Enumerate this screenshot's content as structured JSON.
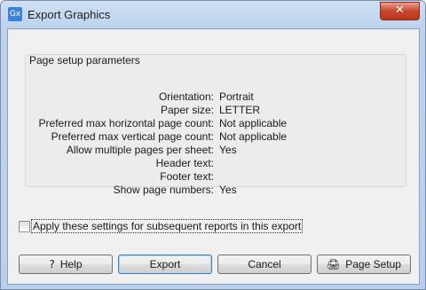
{
  "window": {
    "title": "Export Graphics",
    "app_icon_text": "Gx",
    "close_glyph": "✕"
  },
  "group": {
    "title": "Page setup parameters",
    "rows": [
      {
        "label": "Orientation:",
        "value": "Portrait"
      },
      {
        "label": "Paper size:",
        "value": "LETTER"
      },
      {
        "label": "Preferred max horizontal page count:",
        "value": "Not applicable"
      },
      {
        "label": "Preferred max vertical page count:",
        "value": "Not applicable"
      },
      {
        "label": "Allow multiple pages per sheet:",
        "value": "Yes"
      },
      {
        "label": "Header text:",
        "value": ""
      },
      {
        "label": "Footer text:",
        "value": ""
      },
      {
        "label": "Show page numbers:",
        "value": "Yes"
      }
    ]
  },
  "apply_checkbox": {
    "label": "Apply these settings for subsequent reports in this export",
    "checked": false
  },
  "buttons": {
    "help": {
      "label": "Help",
      "icon": "?"
    },
    "export": {
      "label": "Export"
    },
    "cancel": {
      "label": "Cancel"
    },
    "page_setup": {
      "label": "Page Setup",
      "icon": "🖨"
    }
  }
}
